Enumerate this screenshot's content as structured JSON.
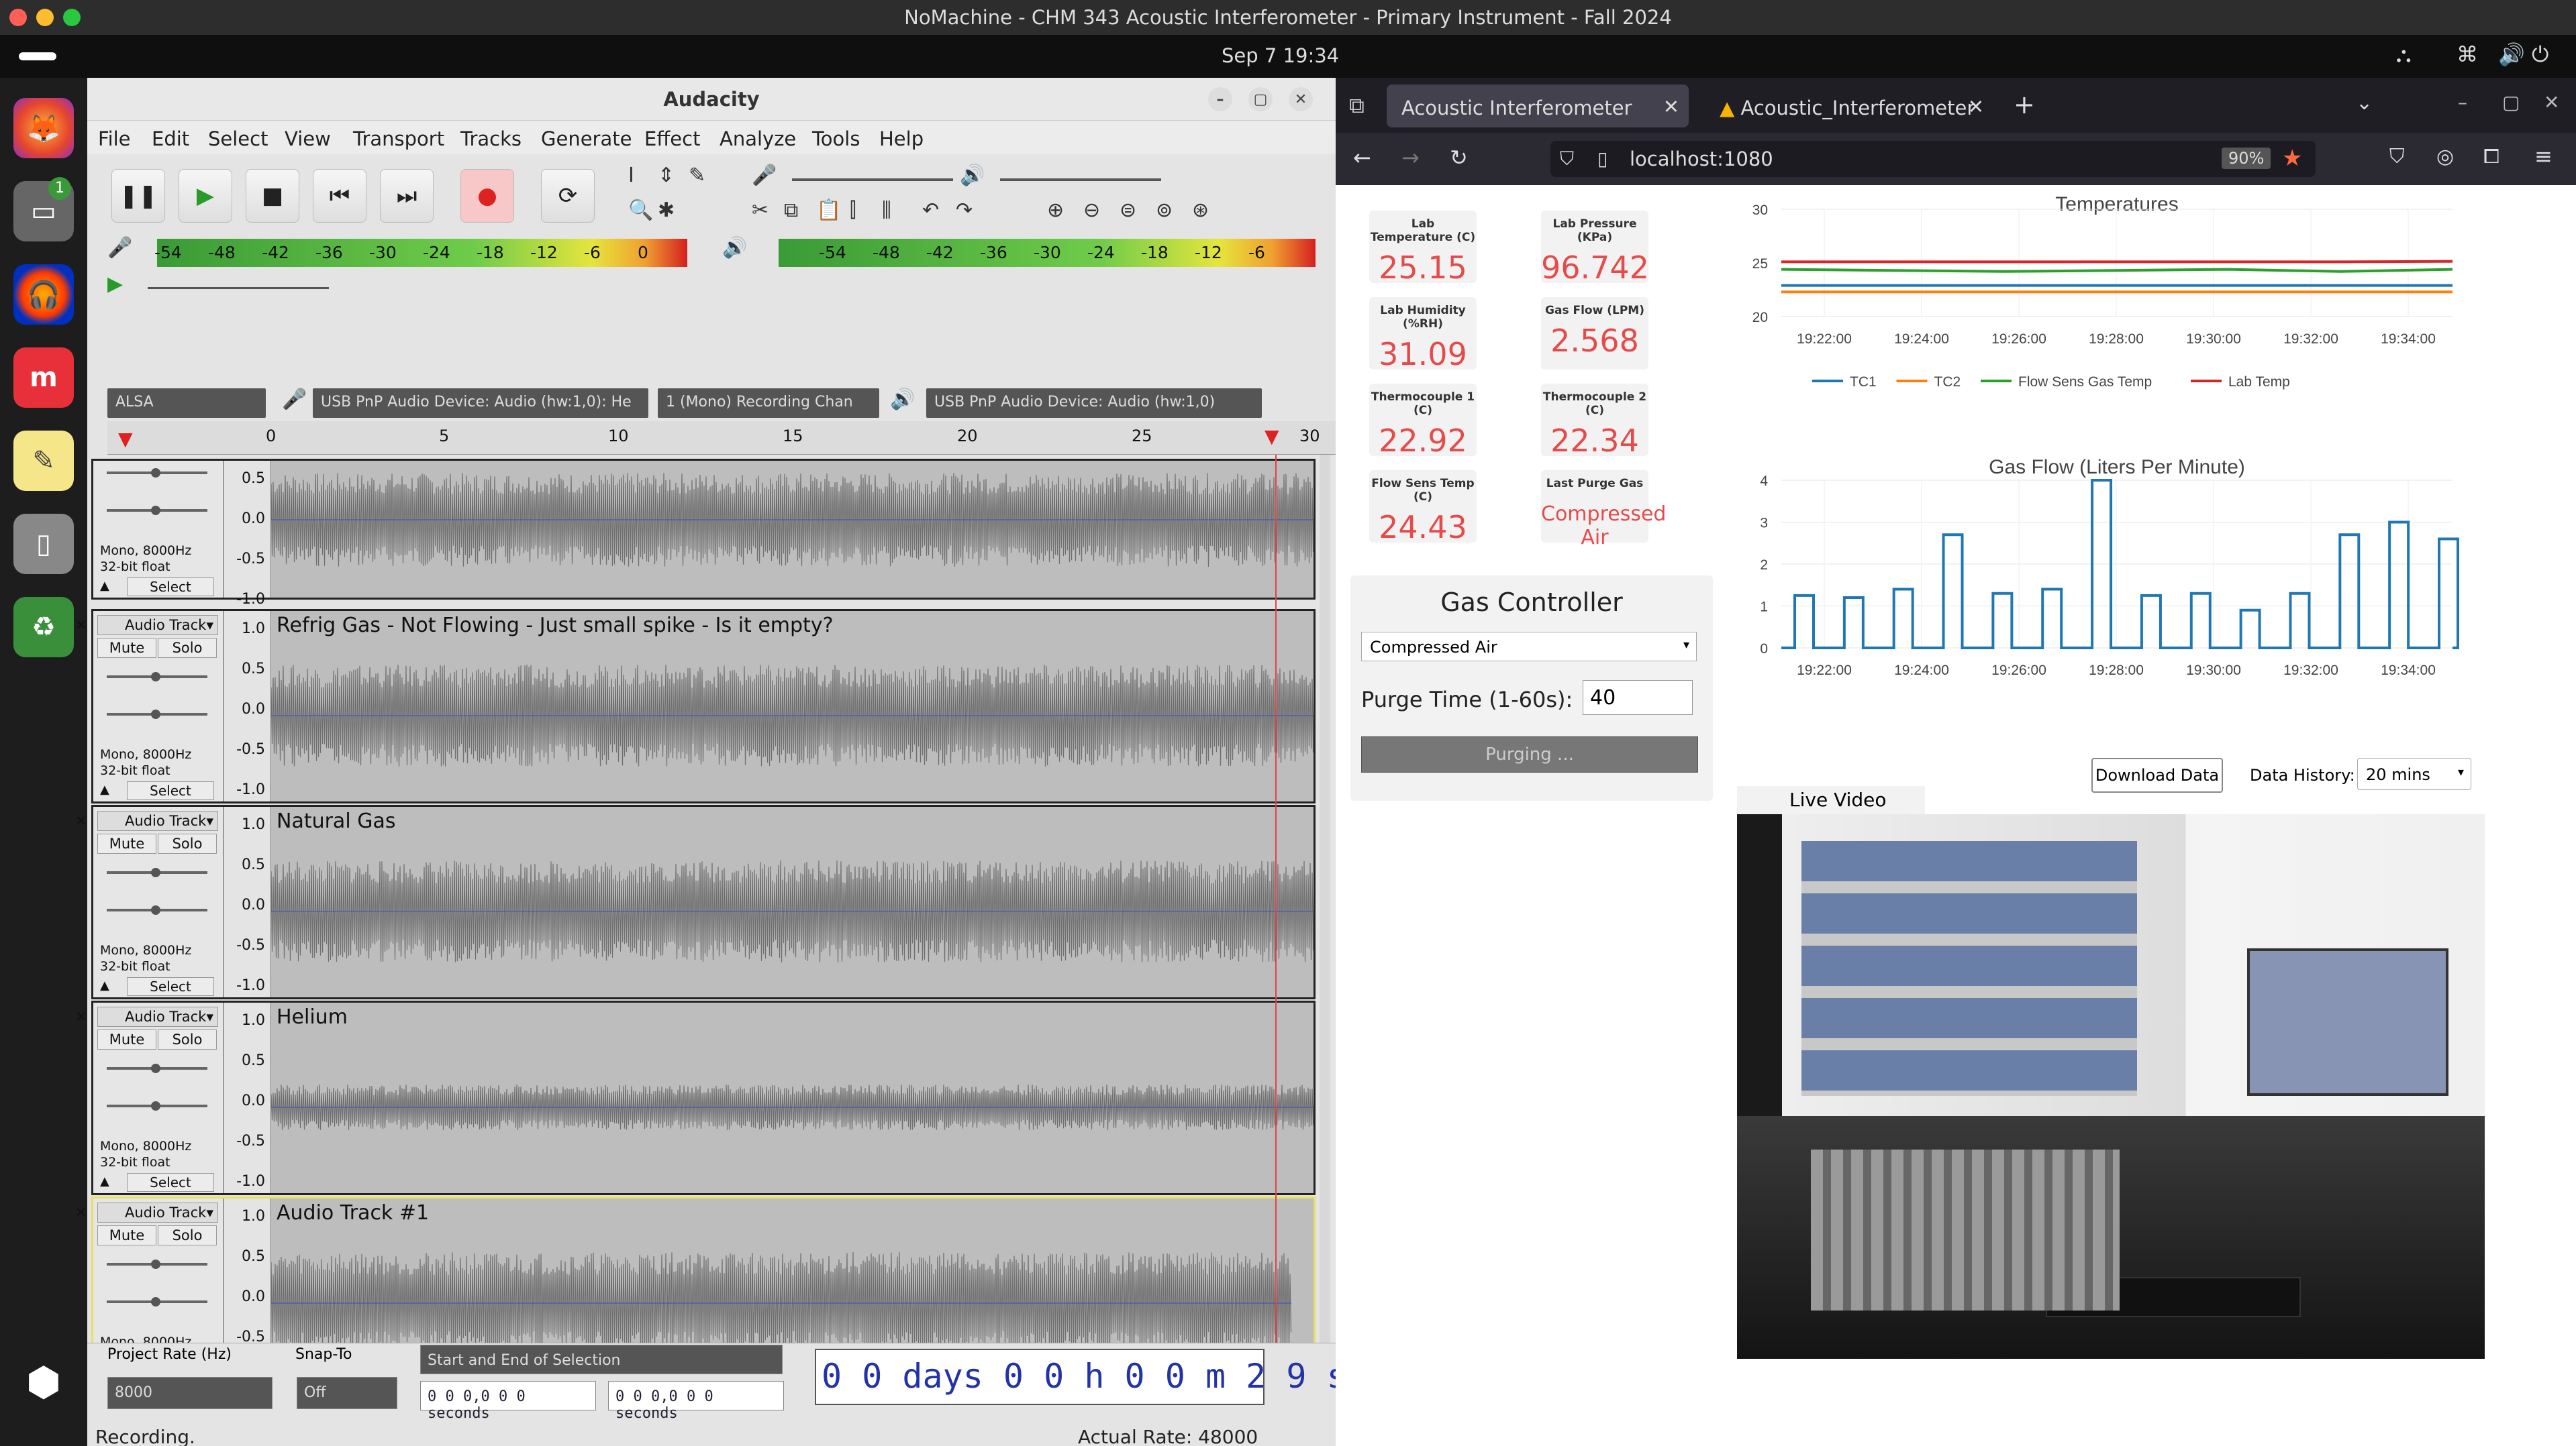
{
  "window_title": "NoMachine - CHM 343 Acoustic Interferometer - Primary Instrument - Fall 2024",
  "clock": "Sep 7  19:34",
  "dock": {
    "badge": "1"
  },
  "audacity": {
    "title": "Audacity",
    "menu": [
      "File",
      "Edit",
      "Select",
      "View",
      "Transport",
      "Tracks",
      "Generate",
      "Effect",
      "Analyze",
      "Tools",
      "Help"
    ],
    "meter_ticks": [
      "-54",
      "-48",
      "-42",
      "-36",
      "-30",
      "-24",
      "-18",
      "-12",
      "-6",
      "0"
    ],
    "play_meter_ticks": [
      "-54",
      "-48",
      "-42",
      "-36",
      "-30",
      "-24",
      "-18",
      "-12",
      "-6"
    ],
    "host": "ALSA",
    "rec_device": "USB PnP Audio Device: Audio (hw:1,0): He",
    "channels": "1 (Mono) Recording Chan",
    "play_device": "USB PnP Audio Device: Audio (hw:1,0)",
    "ruler": [
      "0",
      "5",
      "10",
      "15",
      "20",
      "25",
      "30"
    ],
    "scale": [
      "0.5",
      "0.0",
      "-0.5",
      "-1.0"
    ],
    "scale_full": [
      "1.0",
      "0.5",
      "0.0",
      "-0.5",
      "-1.0"
    ],
    "tracks": [
      {
        "clip": "",
        "menu": "",
        "format": "Mono, 8000Hz\n32-bit float"
      },
      {
        "clip": "Refrig Gas - Not Flowing - Just small spike - Is it empty?",
        "menu": "Audio Track",
        "format": "Mono, 8000Hz\n32-bit float"
      },
      {
        "clip": "Natural Gas",
        "menu": "Audio Track",
        "format": "Mono, 8000Hz\n32-bit float"
      },
      {
        "clip": "Helium",
        "menu": "Audio Track",
        "format": "Mono, 8000Hz\n32-bit float"
      },
      {
        "clip": "Audio Track #1",
        "menu": "Audio Track",
        "format": "Mono, 8000Hz\n32-bit float"
      }
    ],
    "mute": "Mute",
    "solo": "Solo",
    "select": "Select",
    "rate_label": "Project Rate (Hz)",
    "rate": "8000",
    "snap_label": "Snap-To",
    "snap": "Off",
    "selection_mode": "Start and End of Selection",
    "sel_start": "0 0 0,0 0 0  seconds",
    "sel_end": "0 0 0,0 0 0  seconds",
    "time": "0 0  days  0 0  h  0 0  m  2 9  s",
    "status": "Recording.",
    "actual_rate": "Actual Rate: 48000"
  },
  "browser": {
    "tabs": [
      "Acoustic Interferometer",
      "Acoustic_Interferometer"
    ],
    "url": "localhost:1080",
    "zoom": "90%"
  },
  "dashboard": {
    "tiles": [
      {
        "label": "Lab Temperature (C)",
        "value": "25.15"
      },
      {
        "label": "Lab Pressure (KPa)",
        "value": "96.742"
      },
      {
        "label": "Lab Humidity (%RH)",
        "value": "31.09"
      },
      {
        "label": "Gas Flow (LPM)",
        "value": "2.568"
      },
      {
        "label": "Thermocouple 1 (C)",
        "value": "22.92"
      },
      {
        "label": "Thermocouple 2 (C)",
        "value": "22.34"
      },
      {
        "label": "Flow Sens Temp (C)",
        "value": "24.43"
      },
      {
        "label": "Last Purge Gas",
        "value": "Compressed Air"
      }
    ],
    "controller": {
      "title": "Gas Controller",
      "gas": "Compressed Air",
      "purge_label": "Purge Time (1-60s):",
      "purge_value": "40",
      "purge_button": "Purging ..."
    },
    "download": "Download Data",
    "history_label": "Data History:",
    "history": "20 mins",
    "video_label": "Live Video"
  },
  "chart_data": [
    {
      "type": "line",
      "title": "Temperatures",
      "x": [
        "19:22:00",
        "19:24:00",
        "19:26:00",
        "19:28:00",
        "19:30:00",
        "19:32:00",
        "19:34:00"
      ],
      "ylim": [
        20,
        30
      ],
      "yticks": [
        "20",
        "25",
        "30"
      ],
      "series": [
        {
          "name": "TC1",
          "color": "#1f77b4",
          "values": [
            22.9,
            22.9,
            22.9,
            22.9,
            22.9,
            22.9,
            22.9
          ]
        },
        {
          "name": "TC2",
          "color": "#ff7f0e",
          "values": [
            22.3,
            22.3,
            22.3,
            22.3,
            22.3,
            22.3,
            22.3
          ]
        },
        {
          "name": "Flow Sens Gas Temp",
          "color": "#2ca02c",
          "values": [
            24.4,
            24.3,
            24.2,
            24.3,
            24.4,
            24.2,
            24.4
          ]
        },
        {
          "name": "Lab Temp",
          "color": "#d62728",
          "values": [
            25.1,
            25.1,
            25.1,
            25.1,
            25.1,
            25.1,
            25.15
          ]
        }
      ]
    },
    {
      "type": "line",
      "title": "Gas Flow (Liters Per Minute)",
      "x": [
        "19:22:00",
        "19:24:00",
        "19:26:00",
        "19:28:00",
        "19:30:00",
        "19:32:00",
        "19:34:00"
      ],
      "ylim": [
        0,
        4
      ],
      "yticks": [
        "0",
        "1",
        "2",
        "3",
        "4"
      ],
      "series": [
        {
          "name": "",
          "color": "#1f77b4",
          "values": [
            1.25,
            1.2,
            1.4,
            2.7,
            1.3,
            1.4,
            4.0,
            1.25,
            1.3,
            0.9,
            1.3,
            2.7,
            3.0,
            2.6
          ]
        }
      ]
    }
  ]
}
